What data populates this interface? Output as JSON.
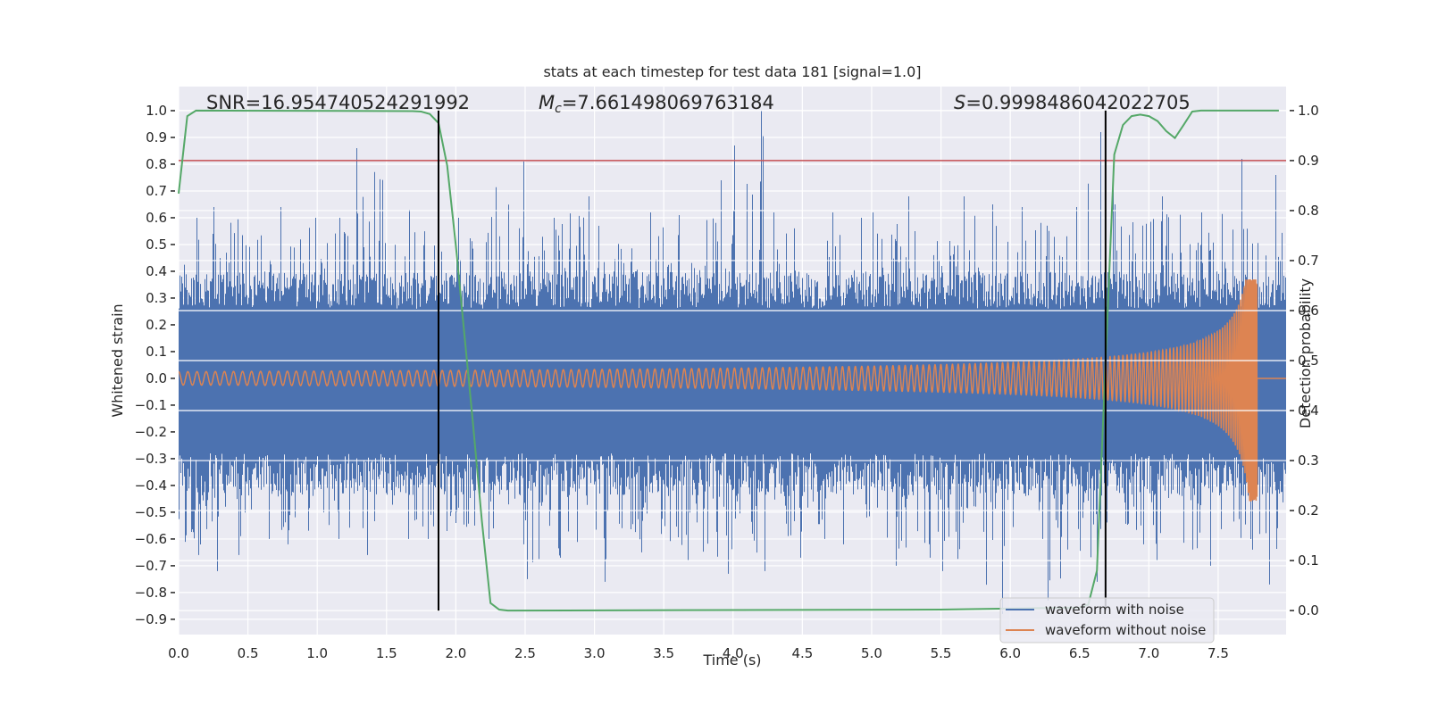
{
  "chart_data": {
    "type": "line",
    "title": "stats at each timestep for test data 181 [signal=1.0]",
    "xlabel": "Time (s)",
    "ylabel": "Whitened strain",
    "ylabel_right": "Detection probability",
    "xlim": [
      0,
      7.99
    ],
    "ylim": [
      -0.957,
      1.09
    ],
    "ylim_right": [
      -0.048,
      1.048
    ],
    "grid": true,
    "legend_placement": "lower-right",
    "x_ticks": [
      "0.0",
      "0.5",
      "1.0",
      "1.5",
      "2.0",
      "2.5",
      "3.0",
      "3.5",
      "4.0",
      "4.5",
      "5.0",
      "5.5",
      "6.0",
      "6.5",
      "7.0",
      "7.5"
    ],
    "x_tick_values": [
      0,
      0.5,
      1,
      1.5,
      2,
      2.5,
      3,
      3.5,
      4,
      4.5,
      5,
      5.5,
      6,
      6.5,
      7,
      7.5
    ],
    "y_ticks": [
      "−0.9",
      "−0.8",
      "−0.7",
      "−0.6",
      "−0.5",
      "−0.4",
      "−0.3",
      "−0.2",
      "−0.1",
      "0.0",
      "0.1",
      "0.2",
      "0.3",
      "0.4",
      "0.5",
      "0.6",
      "0.7",
      "0.8",
      "0.9",
      "1.0"
    ],
    "y_tick_values": [
      -0.9,
      -0.8,
      -0.7,
      -0.6,
      -0.5,
      -0.4,
      -0.3,
      -0.2,
      -0.1,
      0,
      0.1,
      0.2,
      0.3,
      0.4,
      0.5,
      0.6,
      0.7,
      0.8,
      0.9,
      1.0
    ],
    "y_right_ticks": [
      "0.0",
      "0.1",
      "0.2",
      "0.3",
      "0.4",
      "0.5",
      "0.6",
      "0.7",
      "0.8",
      "0.9",
      "1.0"
    ],
    "y_right_tick_values": [
      0,
      0.1,
      0.2,
      0.3,
      0.4,
      0.5,
      0.6,
      0.7,
      0.8,
      0.9,
      1.0
    ],
    "annotations": {
      "snr": "SNR=16.954740524291992",
      "mc_symbol": "M",
      "mc_subscript": "c",
      "mc_value": "=7.661498069763184",
      "s_symbol": "S",
      "s_value": "=0.9998486042022705"
    },
    "series": [
      {
        "name": "waveform with noise",
        "color": "#4c72b0",
        "axis": "left",
        "envelope_bin_width_s": 0.25,
        "bin_max": [
          0.6,
          0.64,
          0.64,
          0.6,
          0.6,
          0.86,
          0.63,
          0.6,
          0.6,
          0.81,
          0.6,
          0.68,
          0.57,
          0.62,
          0.61,
          0.74,
          1.0,
          0.62,
          0.62,
          0.6,
          0.62,
          0.68,
          0.68,
          0.65,
          0.64,
          0.64,
          0.92,
          0.65,
          0.68,
          0.62,
          0.82,
          0.76
        ],
        "bin_min": [
          -0.66,
          -0.72,
          -0.6,
          -0.62,
          -0.6,
          -0.66,
          -0.6,
          -0.6,
          -0.6,
          -0.62,
          -0.75,
          -0.67,
          -0.76,
          -0.65,
          -0.68,
          -0.73,
          -0.72,
          -0.67,
          -0.6,
          -0.62,
          -0.7,
          -0.67,
          -0.72,
          -0.88,
          -0.6,
          -0.83,
          -0.76,
          -0.62,
          -0.68,
          -0.7,
          -0.64,
          -0.77
        ]
      },
      {
        "name": "waveform without noise",
        "color": "#dd8452",
        "axis": "left",
        "initial_amplitude": 0.025,
        "initial_frequency_hz": 15,
        "merger_time_s": 7.78,
        "peak_max": 0.37,
        "peak_min": -0.46
      },
      {
        "color": "#55a868",
        "axis": "right",
        "points": [
          [
            0,
            0.834
          ],
          [
            0.0625,
            0.989
          ],
          [
            0.125,
            1.0
          ],
          [
            1.6875,
            0.999
          ],
          [
            1.75,
            0.998
          ],
          [
            1.8125,
            0.993
          ],
          [
            1.875,
            0.975
          ],
          [
            1.9375,
            0.89
          ],
          [
            2.0,
            0.73
          ],
          [
            2.0625,
            0.55
          ],
          [
            2.125,
            0.37
          ],
          [
            2.1875,
            0.18
          ],
          [
            2.25,
            0.015
          ],
          [
            2.3125,
            0.002
          ],
          [
            2.375,
            0.0
          ],
          [
            5.5,
            0.002
          ],
          [
            6.5,
            0.006
          ],
          [
            6.5625,
            0.012
          ],
          [
            6.625,
            0.08
          ],
          [
            6.6875,
            0.5
          ],
          [
            6.75,
            0.912
          ],
          [
            6.8125,
            0.971
          ],
          [
            6.875,
            0.989
          ],
          [
            6.9375,
            0.992
          ],
          [
            7.0,
            0.989
          ],
          [
            7.0625,
            0.979
          ],
          [
            7.125,
            0.959
          ],
          [
            7.1875,
            0.945
          ],
          [
            7.25,
            0.971
          ],
          [
            7.3125,
            0.998
          ],
          [
            7.375,
            1.0
          ],
          [
            7.9375,
            1.0
          ]
        ]
      }
    ],
    "threshold": {
      "value": 0.9,
      "axis": "right",
      "color": "#c44e52"
    },
    "vertical_markers": {
      "times": [
        1.875,
        6.6875
      ],
      "color": "#000000",
      "range": [
        0,
        1
      ]
    }
  }
}
